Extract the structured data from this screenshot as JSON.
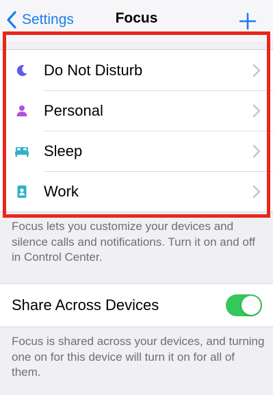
{
  "nav": {
    "back_label": "Settings",
    "title": "Focus",
    "add_icon": "plus-icon"
  },
  "focus_list": [
    {
      "label": "Do Not Disturb",
      "icon": "moon-icon",
      "icon_color": "#5e5ce6"
    },
    {
      "label": "Personal",
      "icon": "person-icon",
      "icon_color": "#af52de"
    },
    {
      "label": "Sleep",
      "icon": "bed-icon",
      "icon_color": "#30b0c7"
    },
    {
      "label": "Work",
      "icon": "id-badge-icon",
      "icon_color": "#30b0c7"
    }
  ],
  "focus_description": "Focus lets you customize your devices and silence calls and notifications. Turn it on and off in Control Center.",
  "share": {
    "label": "Share Across Devices",
    "enabled": true,
    "description": "Focus is shared across your devices, and turning one on for this device will turn it on for all of them."
  },
  "colors": {
    "accent": "#1a7cf0",
    "toggle_on": "#34c759",
    "highlight_border": "#e8261c"
  }
}
